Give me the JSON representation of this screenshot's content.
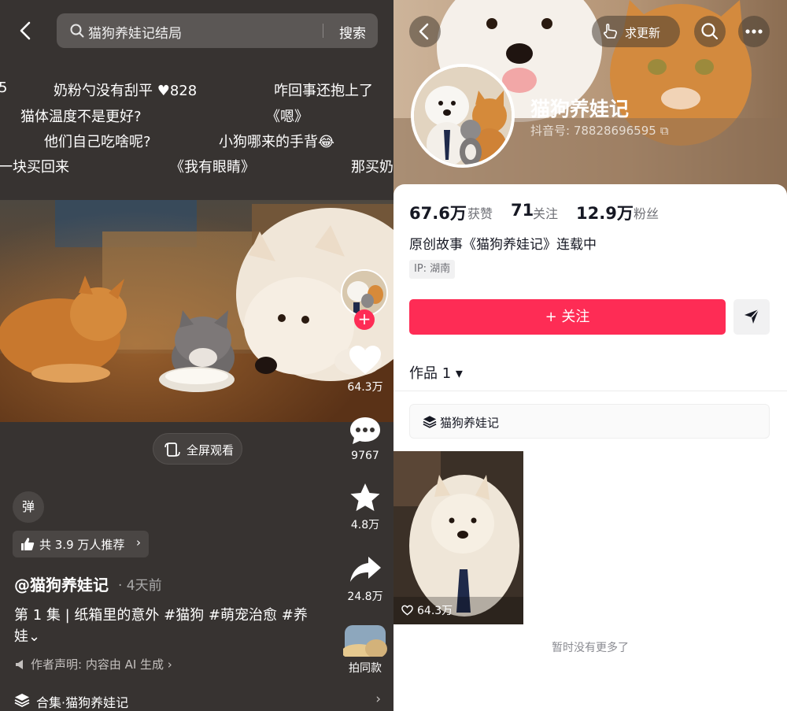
{
  "left": {
    "search": {
      "query": "猫狗养娃记结局",
      "button": "搜索"
    },
    "danmaku": [
      "5",
      "奶粉勺没有刮平 ♥828",
      "咋回事还抱上了",
      "猫体温度不是更好?",
      "《嗯》",
      "他们自己吃啥呢?",
      "小狗哪来的手背😂",
      "一块买回来",
      "《我有眼睛》",
      "那买奶"
    ],
    "fullscreen_label": "全屏观看",
    "actions": {
      "likes": "64.3万",
      "comments": "9767",
      "favorites": "4.8万",
      "shares": "24.8万",
      "same_style": "拍同款"
    },
    "danmaku_toggle": "弹",
    "recommend": "共 3.9 万人推荐",
    "author": "@猫狗养娃记",
    "time": "· 4天前",
    "description": "第 1 集 | 纸箱里的意外 #猫狗 #萌宠治愈 #养娃⌄",
    "disclaimer": "作者声明: 内容由 AI 生成 ›",
    "collection": "合集·猫狗养娃记"
  },
  "right": {
    "request_update": "求更新",
    "profile_name": "猫狗养娃记",
    "douyin_id": "抖音号: 78828696595",
    "stats": {
      "likes_num": "67.6万",
      "likes_label": "获赞",
      "following_num": "71",
      "following_label": "关注",
      "followers_num": "12.9万",
      "followers_label": "粉丝"
    },
    "bio": "原创故事《猫狗养娃记》连载中",
    "ip": "IP: 湖南",
    "follow_button": "+ 关注",
    "works_tab": "作品 1 ▾",
    "collection_label": "猫狗养娃记",
    "thumb_likes": "64.3万",
    "no_more": "暂时没有更多了"
  },
  "colors": {
    "accent": "#fe2c55",
    "dark_bg": "#373331"
  }
}
